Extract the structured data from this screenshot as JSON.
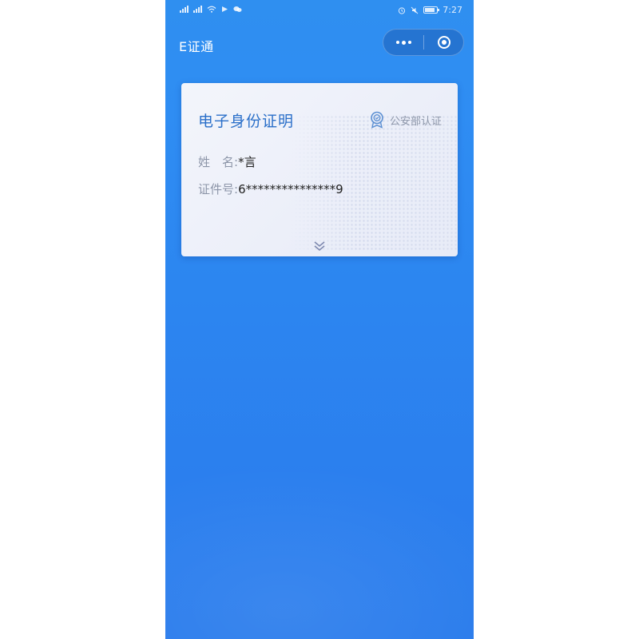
{
  "status_bar": {
    "time": "7:27"
  },
  "nav": {
    "title": "E证通"
  },
  "card": {
    "title": "电子身份证明",
    "certification": "公安部认证",
    "name_label": "姓　名:",
    "name_value": "*言",
    "id_label": "证件号:",
    "id_value": "6***************9"
  },
  "colors": {
    "background": "#2f8ff0",
    "card_title": "#2a6fc9",
    "label_gray": "#8c95a8"
  }
}
